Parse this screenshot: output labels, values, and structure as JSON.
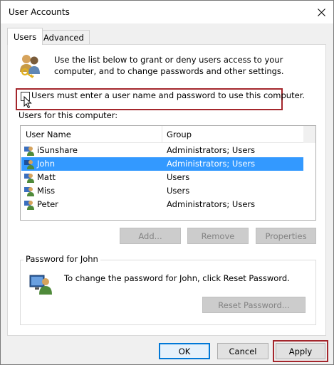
{
  "window": {
    "title": "User Accounts"
  },
  "tabs": [
    {
      "label": "Users",
      "active": true
    },
    {
      "label": "Advanced",
      "active": false
    }
  ],
  "intro": {
    "text": "Use the list below to grant or deny users access to your computer, and to change passwords and other settings.",
    "icon": "users-keys-icon"
  },
  "require_login": {
    "label": "Users must enter a user name and password to use this computer.",
    "checked": false
  },
  "users_list": {
    "caption": "Users for this computer:",
    "columns": [
      "User Name",
      "Group"
    ],
    "rows": [
      {
        "name": "iSunshare",
        "group": "Administrators; Users",
        "selected": false
      },
      {
        "name": "John",
        "group": "Administrators; Users",
        "selected": true
      },
      {
        "name": "Matt",
        "group": "Users",
        "selected": false
      },
      {
        "name": "Miss",
        "group": "Users",
        "selected": false
      },
      {
        "name": "Peter",
        "group": "Administrators; Users",
        "selected": false
      }
    ]
  },
  "list_buttons": {
    "add": "Add...",
    "remove": "Remove",
    "properties": "Properties"
  },
  "password_group": {
    "title": "Password for John",
    "text": "To change the password for John, click Reset Password.",
    "reset_button": "Reset Password..."
  },
  "footer": {
    "ok": "OK",
    "cancel": "Cancel",
    "apply": "Apply"
  },
  "colors": {
    "selection": "#3399ff",
    "highlight_frame": "#a4262c",
    "ok_focus": "#0078d7"
  }
}
